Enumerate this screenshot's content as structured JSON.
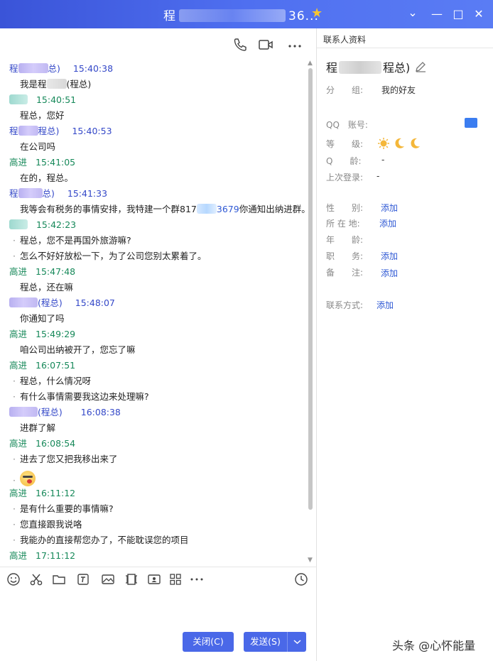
{
  "window": {
    "title_prefix": "程",
    "title_suffix": "36...",
    "star": "★",
    "minimize": "—",
    "maximize": "□",
    "close": "✕",
    "chevron": "⌄"
  },
  "chat_toolbar": {
    "icons": [
      "phone-icon",
      "video-icon",
      "more-icon"
    ]
  },
  "messages": [
    {
      "kind": "head",
      "side": "other",
      "name_a": "程",
      "name_b": "总)",
      "time": "15:40:38"
    },
    {
      "kind": "body",
      "text": "我是程"
    },
    {
      "kind": "head",
      "side": "me",
      "name_a": "",
      "name_b": "",
      "time": "15:40:51"
    },
    {
      "kind": "body",
      "text": "程总，您好"
    },
    {
      "kind": "head",
      "side": "other",
      "name_a": "程",
      "name_b": "程总)",
      "time": "15:40:53"
    },
    {
      "kind": "body",
      "text": "在公司吗"
    },
    {
      "kind": "head",
      "side": "me",
      "name_a": "高进",
      "name_b": "",
      "time": "15:41:05"
    },
    {
      "kind": "body",
      "text": "在的，程总。"
    },
    {
      "kind": "head",
      "side": "other",
      "name_a": "程",
      "name_b": "总)",
      "time": "15:41:33"
    },
    {
      "kind": "body",
      "text": "我等会有税务的事情安排，我特建一个群817",
      "link_tail": "3679",
      "after": "你通知出纳进群。"
    },
    {
      "kind": "head",
      "side": "me",
      "name_a": "",
      "name_b": "",
      "time": "15:42:23"
    },
    {
      "kind": "body",
      "dot": true,
      "text": "程总，您不是再国外旅游嘛?"
    },
    {
      "kind": "body",
      "dot": true,
      "text": "怎么不好好放松一下，为了公司您别太累着了。"
    },
    {
      "kind": "head",
      "side": "me",
      "name_a": "高进",
      "name_b": "",
      "time": "15:47:48"
    },
    {
      "kind": "body",
      "text": "程总，还在嘛"
    },
    {
      "kind": "head",
      "side": "other",
      "name_a": "",
      "name_b": "(程总)",
      "time": "15:48:07"
    },
    {
      "kind": "body",
      "text": "你通知了吗"
    },
    {
      "kind": "head",
      "side": "me",
      "name_a": "高进",
      "name_b": "",
      "time": "15:49:29"
    },
    {
      "kind": "body",
      "text": "咱公司出纳被开了，您忘了嘛"
    },
    {
      "kind": "head",
      "side": "me",
      "name_a": "高进",
      "name_b": "",
      "time": "16:07:51"
    },
    {
      "kind": "body",
      "dot": true,
      "text": "程总，什么情况呀"
    },
    {
      "kind": "body",
      "dot": true,
      "text": "有什么事情需要我这边来处理嘛?"
    },
    {
      "kind": "head",
      "side": "other",
      "name_a": "",
      "name_b": "(程总)",
      "time": "16:08:38"
    },
    {
      "kind": "body",
      "text": "进群了解"
    },
    {
      "kind": "head",
      "side": "me",
      "name_a": "高进",
      "name_b": "",
      "time": "16:08:54"
    },
    {
      "kind": "body",
      "dot": true,
      "text": "进去了您又把我移出来了"
    },
    {
      "kind": "body",
      "dot": true,
      "emoji": true,
      "text": ""
    },
    {
      "kind": "head",
      "side": "me",
      "name_a": "高进",
      "name_b": "",
      "time": "16:11:12"
    },
    {
      "kind": "body",
      "dot": true,
      "text": "是有什么重要的事情嘛?"
    },
    {
      "kind": "body",
      "dot": true,
      "text": "您直接跟我说咯"
    },
    {
      "kind": "body",
      "dot": true,
      "text": "我能办的直接帮您办了，不能耽误您的项目"
    },
    {
      "kind": "head",
      "side": "me",
      "name_a": "高进",
      "name_b": "",
      "time": "17:11:12"
    }
  ],
  "message_texts": {
    "m1_name_b": "总)",
    "m1_body_suffix": "(程总)"
  },
  "input_toolbar": {
    "icons": [
      "emoji-icon",
      "scissors-icon",
      "folder-icon",
      "text-format-icon",
      "image-icon",
      "video-capture-icon",
      "contact-card-icon",
      "apps-grid-icon",
      "more-icon",
      "history-icon"
    ]
  },
  "buttons": {
    "close_label": "关闭(C)",
    "send_label": "发送(S)",
    "send_dropdown": "⌄"
  },
  "contact_panel": {
    "tab_label": "联系人资料",
    "name_prefix": "程",
    "name_suffix": "程总)",
    "group_label": "分　　组:",
    "group_value": "我的好友",
    "qq_label": "QQ　账号:",
    "level_label": "等　　级:",
    "age_label": "Q　　龄:",
    "age_value": "-",
    "last_login_label": "上次登录:",
    "last_login_value": "-",
    "gender_label": "性　　别:",
    "location_label": "所 在 地:",
    "year_label": "年　　龄:",
    "job_label": "职　　务:",
    "remark_label": "备　　注:",
    "contact_label": "联系方式:",
    "add": "添加"
  },
  "watermark": "头条 @心怀能量"
}
